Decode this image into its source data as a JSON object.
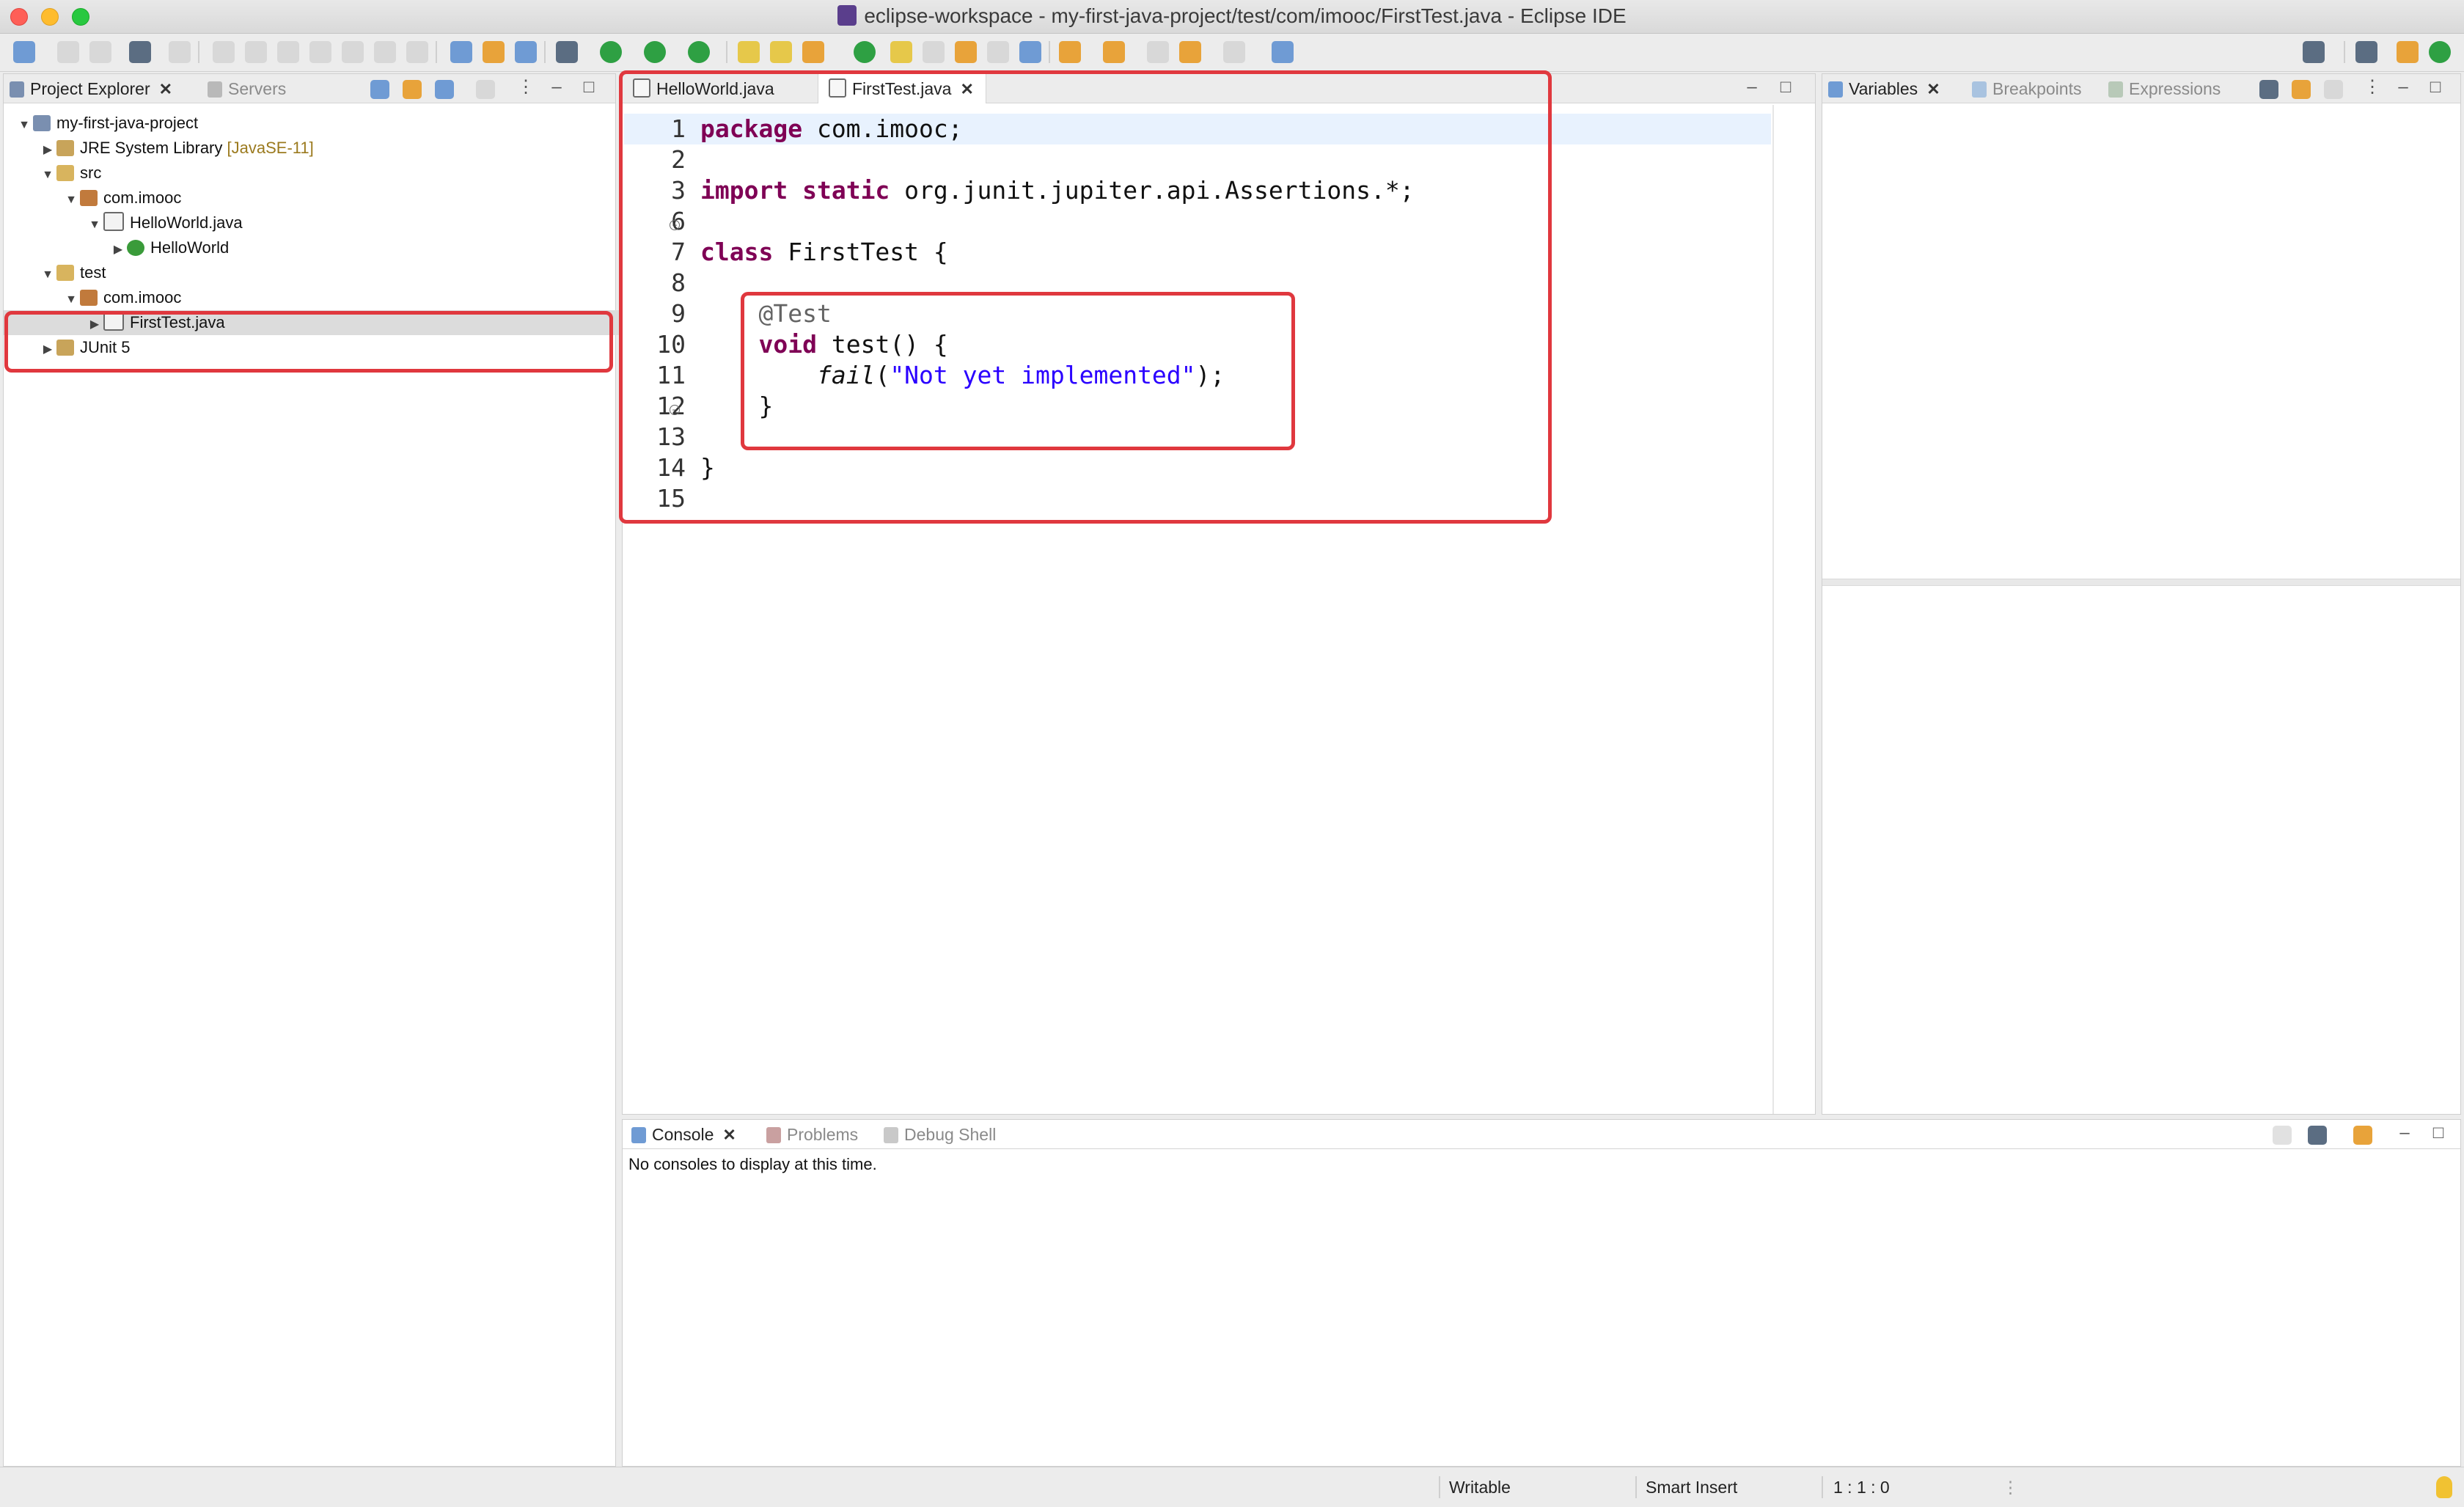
{
  "window": {
    "title": "eclipse-workspace - my-first-java-project/test/com/imooc/FirstTest.java - Eclipse IDE"
  },
  "explorer": {
    "tabs": [
      {
        "label": "Project Explorer",
        "active": true
      },
      {
        "label": "Servers",
        "active": false
      }
    ],
    "tree": [
      {
        "label": "my-first-java-project",
        "depth": 0,
        "expanded": true,
        "icon": "project-icon"
      },
      {
        "label": "JRE System Library",
        "decoration": "[JavaSE-11]",
        "depth": 1,
        "expanded": false,
        "icon": "library-icon"
      },
      {
        "label": "src",
        "depth": 1,
        "expanded": true,
        "icon": "source-folder-icon"
      },
      {
        "label": "com.imooc",
        "depth": 2,
        "expanded": true,
        "icon": "package-icon"
      },
      {
        "label": "HelloWorld.java",
        "depth": 3,
        "expanded": true,
        "icon": "java-file-icon"
      },
      {
        "label": "HelloWorld",
        "depth": 4,
        "expanded": false,
        "icon": "class-icon"
      },
      {
        "label": "test",
        "depth": 1,
        "expanded": true,
        "icon": "source-folder-icon"
      },
      {
        "label": "com.imooc",
        "depth": 2,
        "expanded": true,
        "icon": "package-icon"
      },
      {
        "label": "FirstTest.java",
        "depth": 3,
        "expanded": false,
        "icon": "java-file-icon",
        "selected": true
      },
      {
        "label": "JUnit 5",
        "depth": 1,
        "expanded": false,
        "icon": "library-icon"
      }
    ]
  },
  "editor": {
    "tabs": [
      {
        "label": "HelloWorld.java",
        "active": false
      },
      {
        "label": "FirstTest.java",
        "active": true
      }
    ],
    "lines": [
      {
        "num": "1",
        "segments": [
          {
            "t": "package",
            "c": "kw"
          },
          {
            "t": " com.imooc;",
            "c": ""
          }
        ]
      },
      {
        "num": "2",
        "segments": []
      },
      {
        "num": "3",
        "segments": [
          {
            "t": "import",
            "c": "kw"
          },
          {
            "t": " ",
            "c": ""
          },
          {
            "t": "static",
            "c": "kw"
          },
          {
            "t": " org.junit.jupiter.api.Assertions.*;",
            "c": ""
          }
        ]
      },
      {
        "num": "6",
        "segments": []
      },
      {
        "num": "7",
        "segments": [
          {
            "t": "class",
            "c": "kw"
          },
          {
            "t": " FirstTest {",
            "c": ""
          }
        ]
      },
      {
        "num": "8",
        "segments": []
      },
      {
        "num": "9",
        "segments": [
          {
            "t": "    @Test",
            "c": "ann"
          }
        ]
      },
      {
        "num": "10",
        "segments": [
          {
            "t": "    ",
            "c": ""
          },
          {
            "t": "void",
            "c": "kw"
          },
          {
            "t": " test() {",
            "c": ""
          }
        ]
      },
      {
        "num": "11",
        "segments": [
          {
            "t": "        ",
            "c": ""
          },
          {
            "t": "fail",
            "c": "it"
          },
          {
            "t": "(",
            "c": ""
          },
          {
            "t": "\"Not yet implemented\"",
            "c": "str"
          },
          {
            "t": ");",
            "c": ""
          }
        ]
      },
      {
        "num": "12",
        "segments": [
          {
            "t": "    }",
            "c": ""
          }
        ]
      },
      {
        "num": "13",
        "segments": []
      },
      {
        "num": "14",
        "segments": [
          {
            "t": "}",
            "c": ""
          }
        ]
      },
      {
        "num": "15",
        "segments": []
      }
    ]
  },
  "debug_view": {
    "tabs": [
      {
        "label": "Variables",
        "active": true
      },
      {
        "label": "Breakpoints",
        "active": false
      },
      {
        "label": "Expressions",
        "active": false
      }
    ]
  },
  "console": {
    "tabs": [
      {
        "label": "Console",
        "active": true
      },
      {
        "label": "Problems",
        "active": false
      },
      {
        "label": "Debug Shell",
        "active": false
      }
    ],
    "message": "No consoles to display at this time."
  },
  "status": {
    "writable": "Writable",
    "insert_mode": "Smart Insert",
    "position": "1 : 1 : 0"
  },
  "colors": {
    "highlight_box": "#e0383e",
    "keyword": "#7f0055",
    "string": "#2a00ff",
    "annotation": "#646464"
  }
}
